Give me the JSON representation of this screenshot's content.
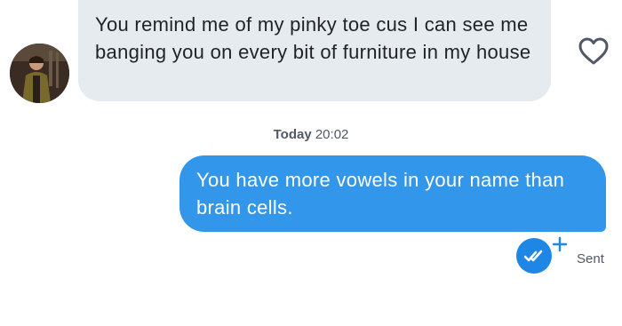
{
  "incoming_message": {
    "text": "You remind me of my pinky toe cus I can see me banging you on every bit of furniture in my house"
  },
  "divider": {
    "day": "Today",
    "time": "20:02"
  },
  "outgoing_message": {
    "text": "You have more vowels in your name than brain cells."
  },
  "status": {
    "label": "Sent"
  },
  "colors": {
    "incoming_bubble": "#e6ebef",
    "outgoing_bubble": "#3296ea",
    "read_receipt": "#1e86e5",
    "secondary_text": "#505965"
  },
  "icons": {
    "avatar": "profile-photo",
    "like": "heart-outline-icon",
    "receipt": "double-check-icon",
    "add": "plus-icon"
  }
}
